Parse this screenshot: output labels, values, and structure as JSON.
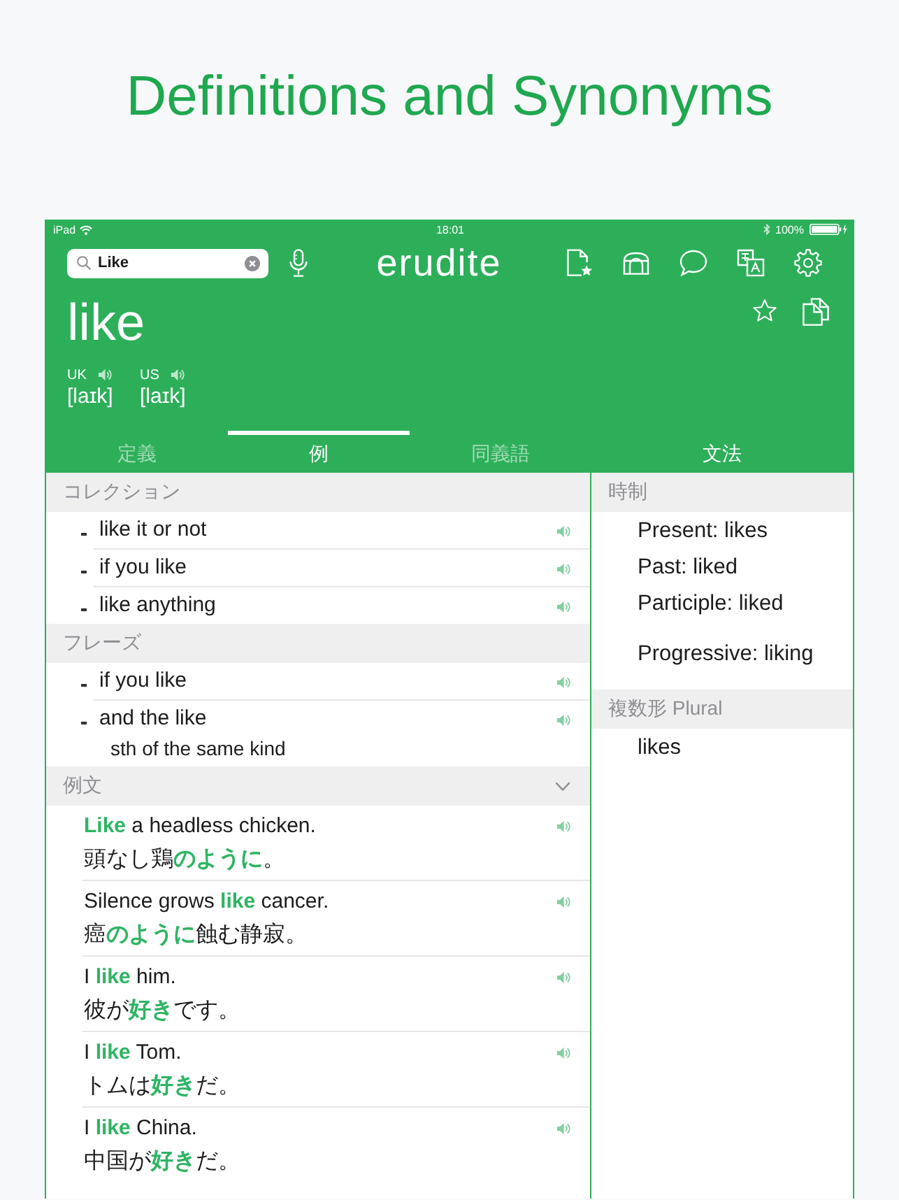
{
  "page_title": "Definitions and Synonyms",
  "status_bar": {
    "device": "iPad",
    "time": "18:01",
    "battery": "100%"
  },
  "search": {
    "value": "Like"
  },
  "logo": "erudite",
  "entry": {
    "word": "like",
    "pronunciations": [
      {
        "region": "UK",
        "ipa": "[laɪk]"
      },
      {
        "region": "US",
        "ipa": "[laɪk]"
      }
    ]
  },
  "tabs": [
    {
      "label": "定義",
      "selected": false
    },
    {
      "label": "例",
      "selected": true
    },
    {
      "label": "同義語",
      "selected": false
    }
  ],
  "left_sections": [
    {
      "kind": "list",
      "title": "コレクション",
      "items": [
        {
          "text": "like it or not"
        },
        {
          "text": "if you like"
        },
        {
          "text": "like anything"
        }
      ]
    },
    {
      "kind": "list",
      "title": "フレーズ",
      "items": [
        {
          "text": "if you like"
        },
        {
          "text": "and the like",
          "note": "sth of the same kind"
        }
      ]
    },
    {
      "kind": "examples",
      "title": "例文",
      "expanded": true,
      "items": [
        {
          "en": "**Like** a headless chicken.",
          "ja": "頭なし鶏**のように**。"
        },
        {
          "en": "Silence grows **like** cancer.",
          "ja": "癌**のように**蝕む静寂。"
        },
        {
          "en": "I **like** him.",
          "ja": "彼が**好き**です。"
        },
        {
          "en": "I **like** Tom.",
          "ja": "トムは**好き**だ。"
        },
        {
          "en": "I **like** China.",
          "ja": "中国が**好き**だ。"
        }
      ]
    }
  ],
  "grammar": {
    "tab": "文法",
    "sections": [
      {
        "title": "時制",
        "groups": [
          [
            "Present: likes",
            "Past: liked",
            "Participle: liked"
          ],
          [
            "Progressive: liking"
          ]
        ]
      },
      {
        "title": "複数形 Plural",
        "groups": [
          [
            "likes"
          ]
        ]
      }
    ]
  }
}
